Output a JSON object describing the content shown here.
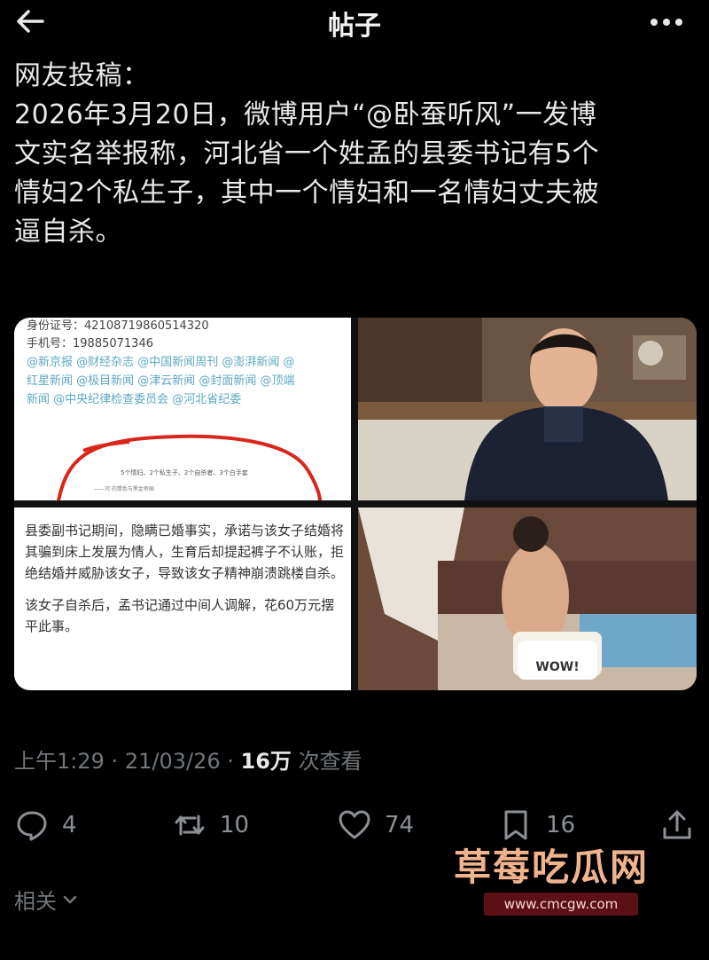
{
  "header": {
    "title": "帖子",
    "back_icon": "arrow-left-icon",
    "more_icon": "more-horizontal-icon"
  },
  "post": {
    "text": "网友投稿：\n2026年3月20日，微博用户“@卧蚕听风”一发博\n文实名举报称，河北省一个姓孟的县委书记有5个\n情妇2个私生子，其中一个情妇和一名情妇丈夫被\n逼自杀。"
  },
  "media": {
    "doc1": {
      "id_label": "身份证号：42108719860514320",
      "phone_label": "手机号：19885071346",
      "tags_line1": "@新京报 @财经杂志 @中国新闻周刊 @澎湃新闻 @",
      "tags_line2": "红星新闻 @极目新闻 @津云新闻 @封面新闻 @顶端",
      "tags_line3": "新闻 @中央纪律检查委员会 @河北省纪委",
      "note": "5个情妇、2个私生子、2个自杀者、3个白手套",
      "note2": "——河 的情色与黑金帝国"
    },
    "doc3": {
      "para1": "县委副书记期间，隐瞒已婚事实，承诺与该女子结婚将其骗到床上发展为情人，生育后却提起裤子不认账，拒绝结婚并威胁该女子，导致该女子精神崩溃跳楼自杀。",
      "para2": "该女子自杀后，孟书记通过中间人调解，花60万元摆平此事。"
    },
    "sticker_text": "WOW!"
  },
  "meta": {
    "time": "上午1:29",
    "date": "21/03/26",
    "views": "16万",
    "views_label": "次查看"
  },
  "actions": {
    "reply_count": "4",
    "repost_count": "10",
    "like_count": "74",
    "bookmark_count": "16"
  },
  "related": {
    "label": "相关"
  },
  "watermark": {
    "title": "草莓吃瓜网",
    "url": "www.cmcgw.com"
  },
  "colors": {
    "background": "#000000",
    "text": "#e7e9ea",
    "muted": "#71767b",
    "watermark": "#f0b38d",
    "link_tags": "#5da8c4"
  }
}
